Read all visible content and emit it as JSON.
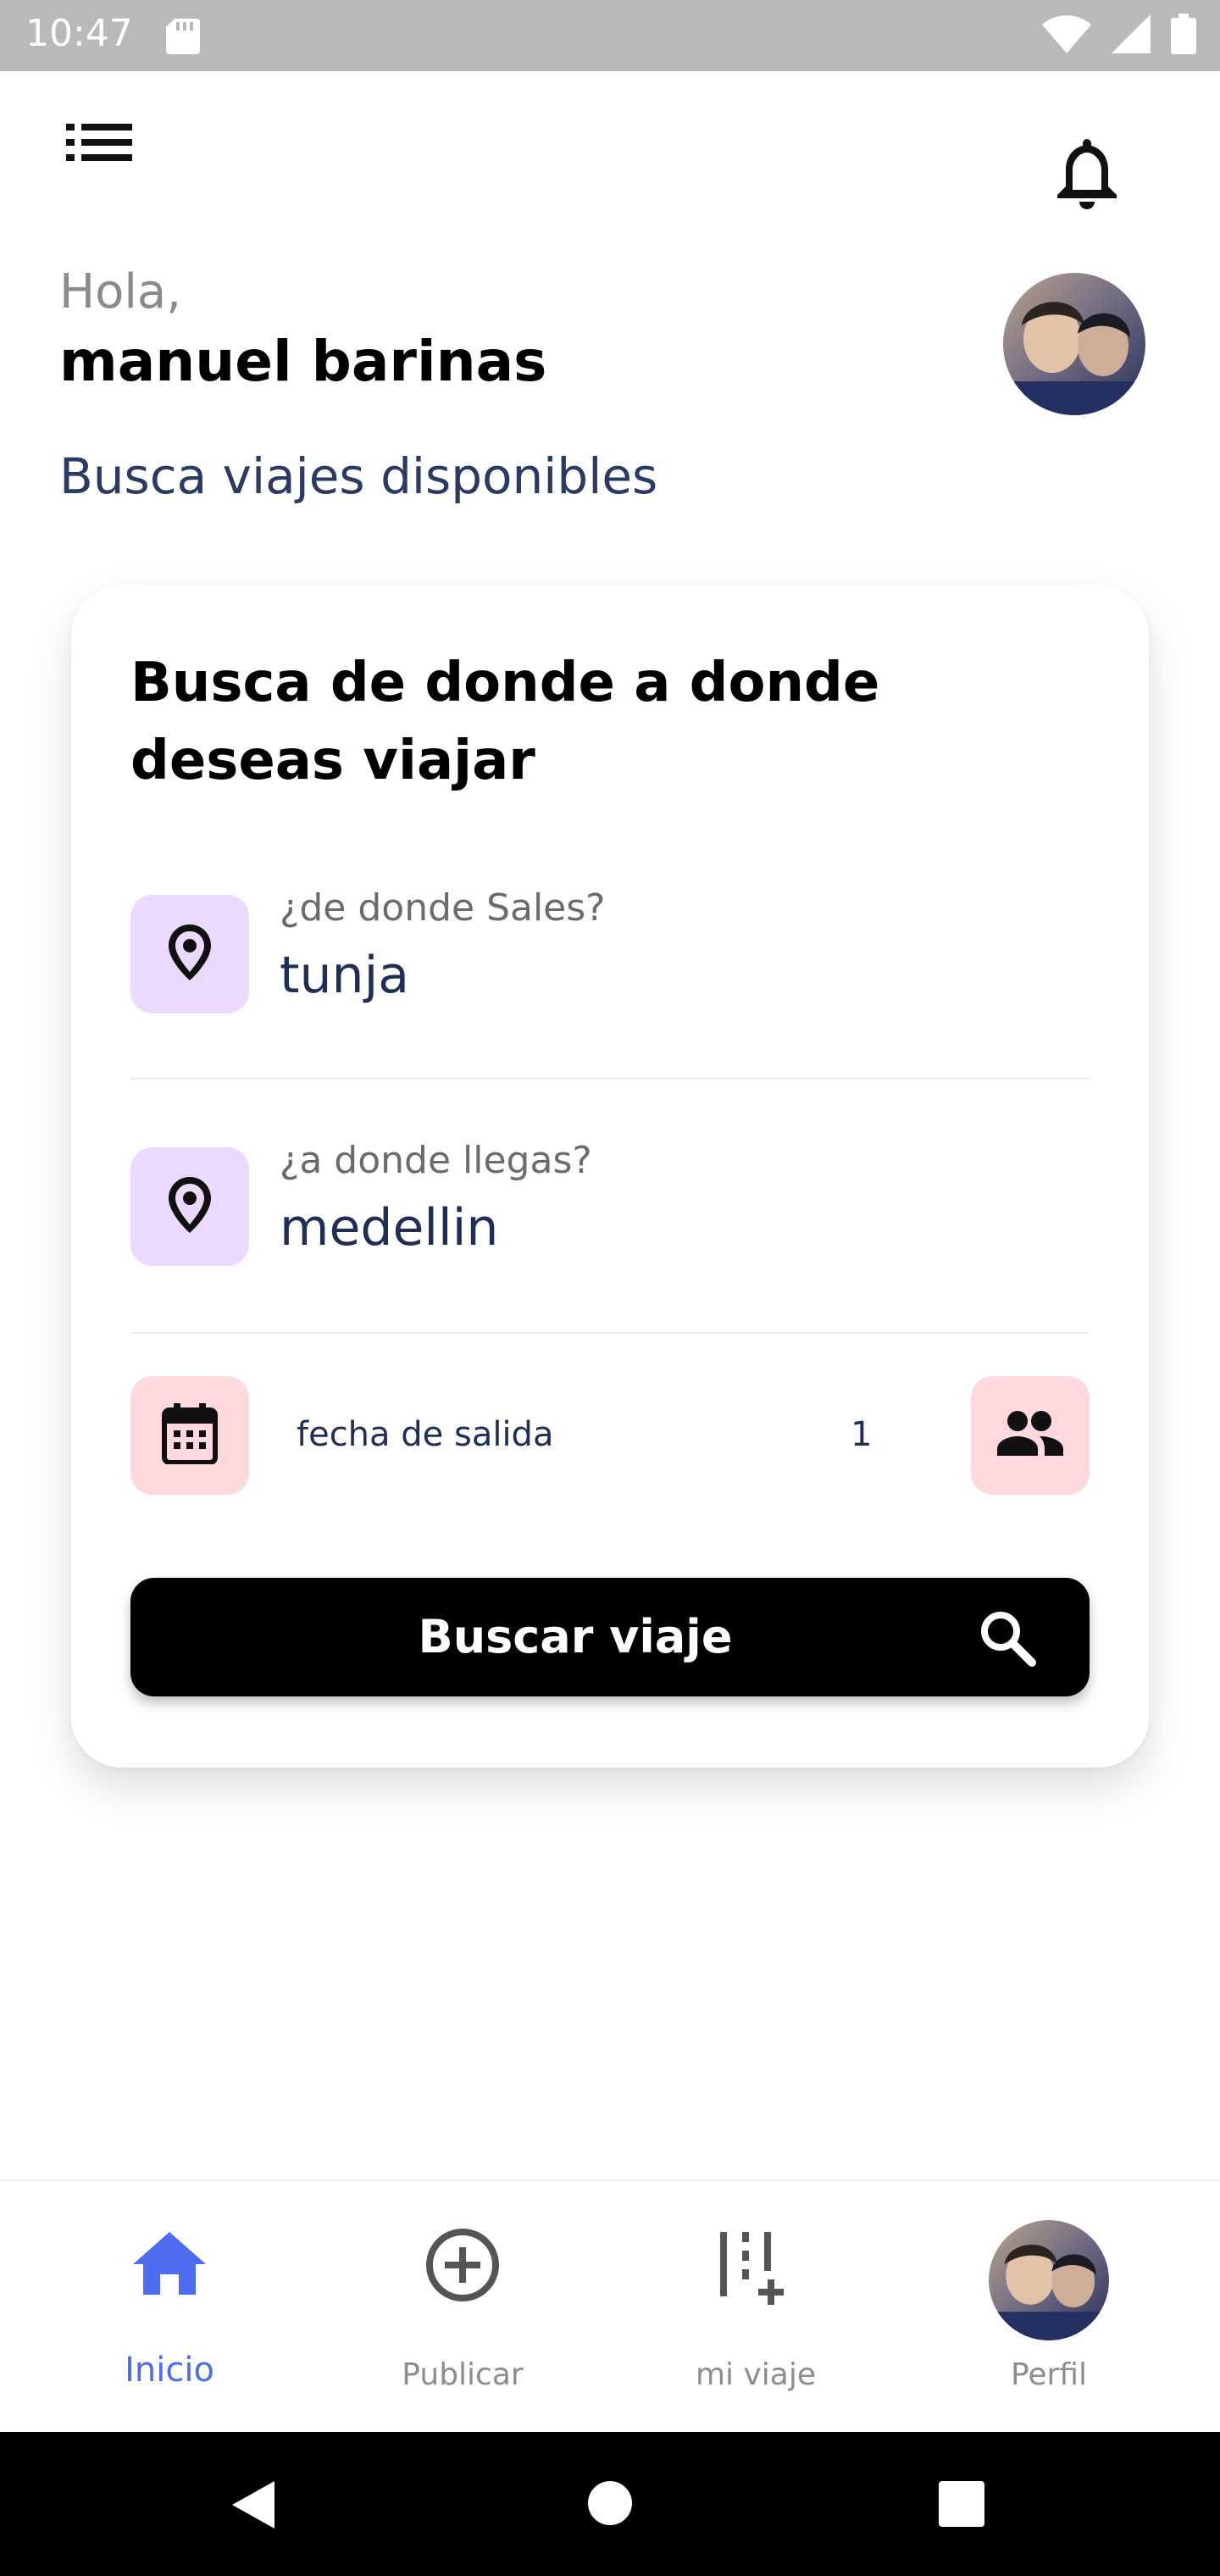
{
  "status_bar": {
    "time": "10:47",
    "icons": [
      "sd-card-icon",
      "wifi-icon",
      "cell-signal-icon",
      "battery-icon"
    ]
  },
  "header": {
    "menu_icon": "list-menu-icon",
    "bell_icon": "bell-icon",
    "greeting": "Hola,",
    "user_name": "manuel barinas",
    "subtitle": "Busca viajes disponibles"
  },
  "card": {
    "title": "Busca de donde a donde deseas viajar",
    "origin": {
      "label": "¿de donde Sales?",
      "value": "tunja",
      "icon": "location-pin-icon"
    },
    "destination": {
      "label": "¿a donde llegas?",
      "value": "medellin",
      "icon": "location-pin-icon"
    },
    "date": {
      "label": "fecha de salida",
      "icon": "calendar-icon"
    },
    "passengers": {
      "count": "1",
      "icon": "people-icon"
    },
    "search_button": {
      "label": "Buscar viaje",
      "icon": "search-icon"
    }
  },
  "bottom_nav": {
    "items": [
      {
        "label": "Inicio",
        "icon": "home-icon",
        "active": true
      },
      {
        "label": "Publicar",
        "icon": "add-circle-icon",
        "active": false
      },
      {
        "label": "mi viaje",
        "icon": "route-add-icon",
        "active": false
      },
      {
        "label": "Perfil",
        "icon": "avatar",
        "active": false
      }
    ]
  },
  "colors": {
    "accent": "#4e6cf0",
    "purple_box": "#ecd9ff",
    "pink_box": "#ffd9dd",
    "navy_text": "#1f2e55"
  }
}
